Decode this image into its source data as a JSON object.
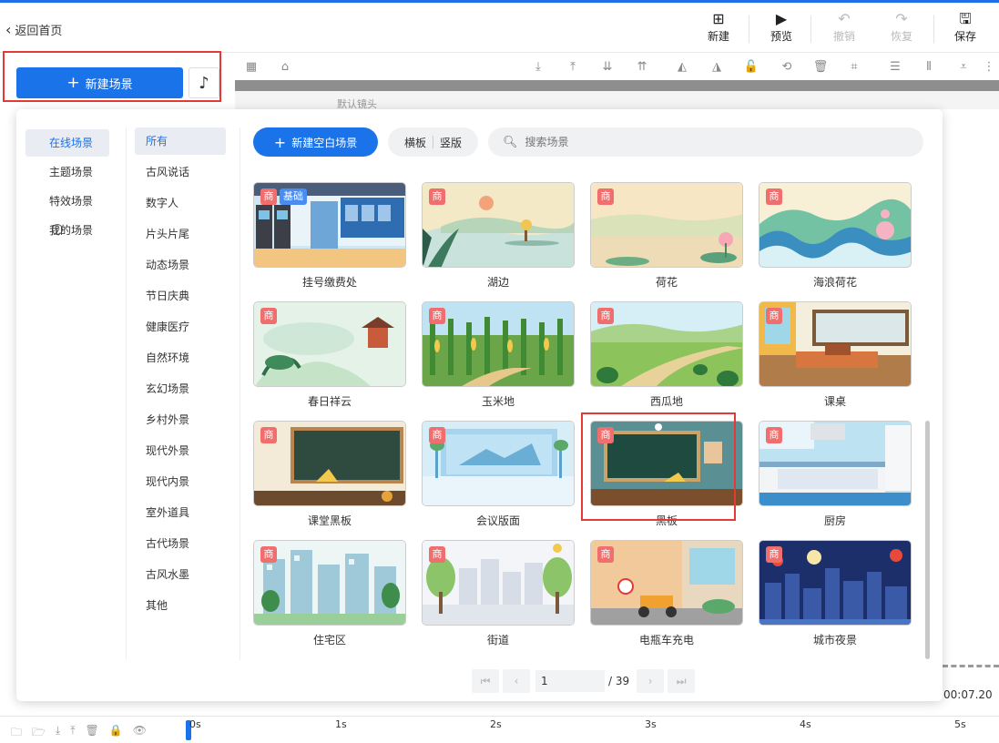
{
  "header": {
    "back_label": "返回首页",
    "buttons": [
      {
        "label": "新建",
        "icon": "plus-square-icon",
        "enabled": true
      },
      {
        "label": "预览",
        "icon": "play-icon",
        "enabled": true
      },
      {
        "label": "撤销",
        "icon": "undo-icon",
        "enabled": false
      },
      {
        "label": "恢复",
        "icon": "redo-icon",
        "enabled": false
      },
      {
        "label": "保存",
        "icon": "save-icon",
        "enabled": true
      }
    ]
  },
  "left_panel": {
    "new_scene_label": "新建场景",
    "music_icon": "music-note-icon"
  },
  "canvas": {
    "default_shot_label": "默认镜头",
    "timecode": "00:07.20"
  },
  "timeline": {
    "ticks": [
      "0s",
      "1s",
      "2s",
      "3s",
      "4s",
      "5s"
    ]
  },
  "modal": {
    "categories": [
      "在线场景",
      "主题场景",
      "特效场景",
      "我的场景"
    ],
    "active_category": "在线场景",
    "subcategories": [
      "所有",
      "古风说话",
      "数字人",
      "片头片尾",
      "动态场景",
      "节日庆典",
      "健康医疗",
      "自然环境",
      "玄幻场景",
      "乡村外景",
      "现代外景",
      "现代内景",
      "室外道具",
      "古代场景",
      "古风水墨",
      "其他"
    ],
    "active_subcategory": "所有",
    "new_blank_label": "新建空白场景",
    "orientation": {
      "landscape": "横板",
      "portrait": "竖版"
    },
    "search_placeholder": "搜索场景",
    "scenes": [
      {
        "name": "挂号缴费处",
        "badge": "商",
        "extra_badge": "基础"
      },
      {
        "name": "湖边",
        "badge": "商"
      },
      {
        "name": "荷花",
        "badge": "商"
      },
      {
        "name": "海浪荷花",
        "badge": "商"
      },
      {
        "name": "春日祥云",
        "badge": "商"
      },
      {
        "name": "玉米地",
        "badge": "商"
      },
      {
        "name": "西瓜地",
        "badge": "商"
      },
      {
        "name": "课桌",
        "badge": "商"
      },
      {
        "name": "课堂黑板",
        "badge": "商"
      },
      {
        "name": "会议版面",
        "badge": "商"
      },
      {
        "name": "黑板",
        "badge": "商"
      },
      {
        "name": "厨房",
        "badge": "商"
      },
      {
        "name": "住宅区",
        "badge": "商"
      },
      {
        "name": "街道",
        "badge": "商"
      },
      {
        "name": "电瓶车充电",
        "badge": "商"
      },
      {
        "name": "城市夜景",
        "badge": "商"
      }
    ],
    "pagination": {
      "current": "1",
      "total": "/ 39"
    }
  }
}
